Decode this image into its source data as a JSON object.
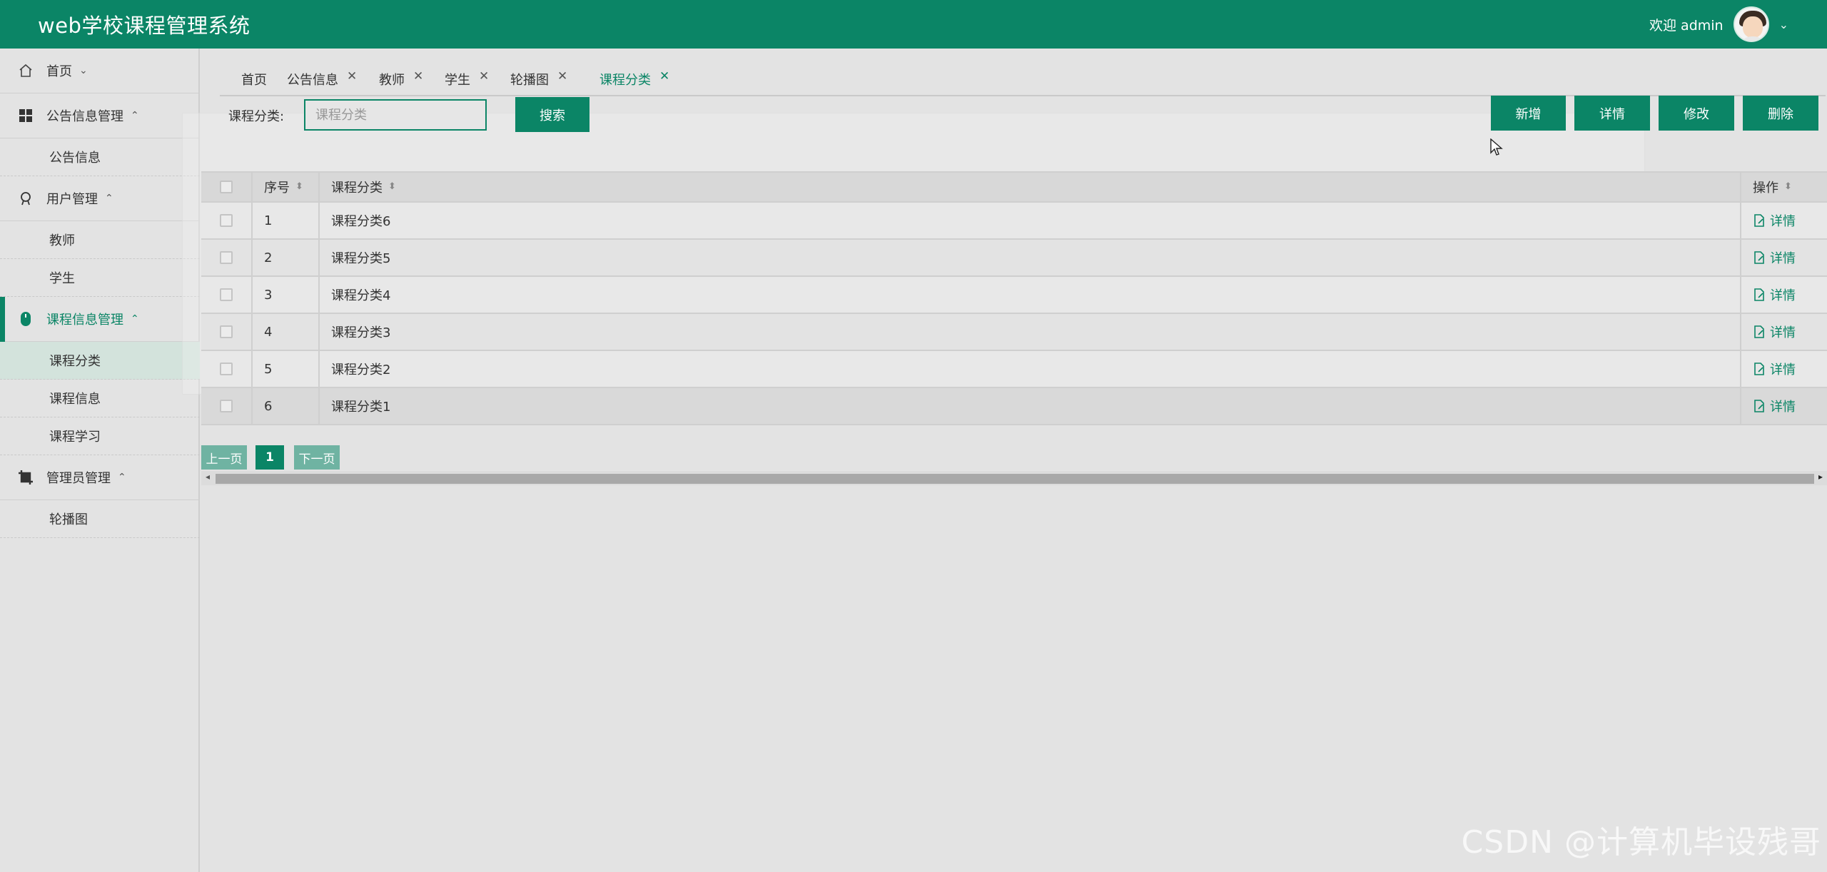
{
  "app": {
    "title": "web学校课程管理系统"
  },
  "user": {
    "welcome": "欢迎 admin"
  },
  "sidebar": {
    "groups": [
      {
        "label": "首页",
        "icon": "home-icon"
      },
      {
        "label": "公告信息管理",
        "icon": "grid-icon",
        "items": [
          "公告信息"
        ]
      },
      {
        "label": "用户管理",
        "icon": "user-badge-icon",
        "items": [
          "教师",
          "学生"
        ]
      },
      {
        "label": "课程信息管理",
        "icon": "mouse-icon",
        "items": [
          "课程分类",
          "课程信息",
          "课程学习"
        ],
        "active": true
      },
      {
        "label": "管理员管理",
        "icon": "crop-icon",
        "items": [
          "轮播图"
        ]
      }
    ],
    "selected_item": "课程分类"
  },
  "tabs": [
    {
      "label": "首页"
    },
    {
      "label": "公告信息",
      "closable": true
    },
    {
      "label": "教师",
      "closable": true
    },
    {
      "label": "学生",
      "closable": true
    },
    {
      "label": "轮播图",
      "closable": true
    },
    {
      "label": "课程分类",
      "closable": true,
      "active": true
    }
  ],
  "search": {
    "label": "课程分类:",
    "placeholder": "课程分类",
    "button": "搜索"
  },
  "toolbar": {
    "add": "新增",
    "detail": "详情",
    "edit": "修改",
    "delete": "删除"
  },
  "table": {
    "columns": [
      "序号",
      "课程分类",
      "操作"
    ],
    "rows": [
      {
        "seq": "1",
        "name": "课程分类6",
        "action": "详情"
      },
      {
        "seq": "2",
        "name": "课程分类5",
        "action": "详情"
      },
      {
        "seq": "3",
        "name": "课程分类4",
        "action": "详情"
      },
      {
        "seq": "4",
        "name": "课程分类3",
        "action": "详情"
      },
      {
        "seq": "5",
        "name": "课程分类2",
        "action": "详情"
      },
      {
        "seq": "6",
        "name": "课程分类1",
        "action": "详情"
      }
    ]
  },
  "pagination": {
    "prev": "上一页",
    "current": "1",
    "next": "下一页"
  },
  "watermark": "CSDN @计算机毕设残哥",
  "colors": {
    "primary": "#0b8566",
    "background": "#e3e3e3",
    "pager_light": "#6fb3a2"
  }
}
